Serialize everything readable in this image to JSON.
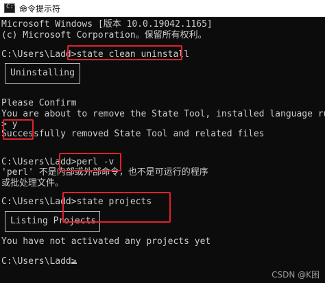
{
  "window": {
    "title": "命令提示符",
    "icon": "terminal-icon",
    "icon_glyph": "C:\\"
  },
  "console": {
    "lines": [
      "Microsoft Windows [版本 10.0.19042.1165]",
      "(c) Microsoft Corporation。保留所有权利。",
      "C:\\Users\\Ladd>state clean uninstall",
      "Please Confirm",
      "You are about to remove the State Tool, installed language runtim",
      "> y",
      "Successfully removed State Tool and related files",
      "C:\\Users\\Ladd>perl -v",
      "'perl' 不是内部或外部命令，也不是可运行的程序",
      "或批处理文件。",
      "C:\\Users\\Ladd>state projects",
      "You have not activated any projects yet",
      "C:\\Users\\Ladd>"
    ],
    "boxes": [
      "Uninstalling",
      "Listing Projects"
    ]
  },
  "watermark": "CSDN @K困",
  "colors": {
    "console_bg": "#0c0c0c",
    "console_text": "#cccccc",
    "highlight": "#e0212e"
  }
}
